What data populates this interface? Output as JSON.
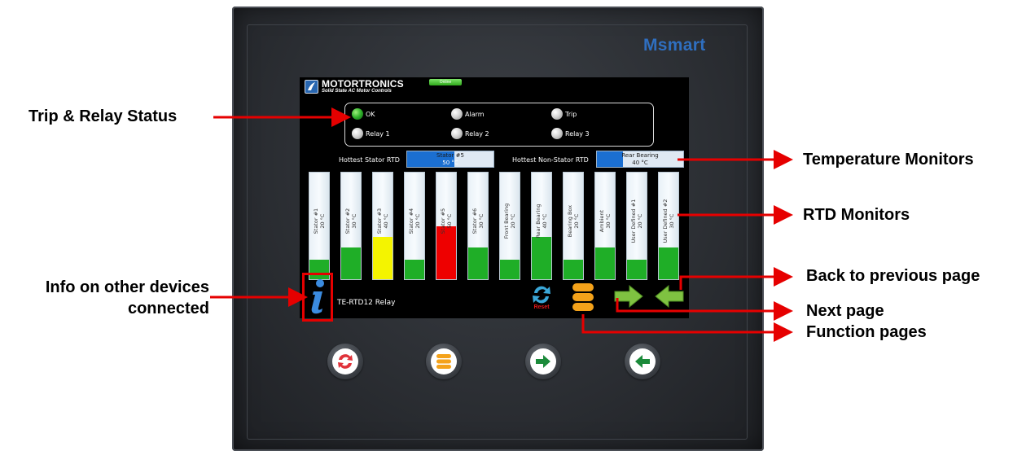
{
  "device": {
    "brand": "Msmart"
  },
  "screen": {
    "logo_title": "MOTORTRONICS",
    "logo_subtitle": "Solid State AC Motor Controls",
    "online_label": "Online",
    "status_lamps": [
      {
        "label": "OK",
        "state": "on"
      },
      {
        "label": "Alarm",
        "state": "off"
      },
      {
        "label": "Trip",
        "state": "off"
      },
      {
        "label": "Relay 1",
        "state": "off"
      },
      {
        "label": "Relay 2",
        "state": "off"
      },
      {
        "label": "Relay 3",
        "state": "off"
      }
    ],
    "hottest_stator": {
      "label": "Hottest Stator RTD",
      "name": "Stator #5",
      "value": "50 °C",
      "fill_fraction": 0.55
    },
    "hottest_non_stator": {
      "label": "Hottest Non-Stator RTD",
      "name": "Rear Bearing",
      "value": "40 °C",
      "fill_fraction": 0.3
    },
    "rtds": [
      {
        "name": "Stator #1",
        "value": "20 °C",
        "level": 0.18,
        "color": "#1fae27"
      },
      {
        "name": "Stator #2",
        "value": "30 °C",
        "level": 0.3,
        "color": "#1fae27"
      },
      {
        "name": "Stator #3",
        "value": "40 °C",
        "level": 0.4,
        "color": "#f4f400"
      },
      {
        "name": "Stator #4",
        "value": "20 °C",
        "level": 0.18,
        "color": "#1fae27"
      },
      {
        "name": "Stator #5",
        "value": "50 °C",
        "level": 0.5,
        "color": "#ee0000"
      },
      {
        "name": "Stator #6",
        "value": "30 °C",
        "level": 0.3,
        "color": "#1fae27"
      },
      {
        "name": "Front Bearing",
        "value": "20 °C",
        "level": 0.18,
        "color": "#1fae27"
      },
      {
        "name": "Rear Bearing",
        "value": "40 °C",
        "level": 0.4,
        "color": "#1fae27"
      },
      {
        "name": "Bearing Box",
        "value": "20 °C",
        "level": 0.18,
        "color": "#1fae27"
      },
      {
        "name": "Ambient",
        "value": "30 °C",
        "level": 0.3,
        "color": "#1fae27"
      },
      {
        "name": "User Defined #1",
        "value": "20 °C",
        "level": 0.18,
        "color": "#1fae27"
      },
      {
        "name": "User Defined #2",
        "value": "30 °C",
        "level": 0.3,
        "color": "#1fae27"
      }
    ],
    "relay_name": "TE-RTD12 Relay",
    "reset_label": "Reset"
  },
  "annotations": {
    "trip_relay_status": "Trip & Relay Status",
    "temperature_monitors": "Temperature Monitors",
    "rtd_monitors": "RTD Monitors",
    "back_previous_page": "Back to previous page",
    "info_line1": "Info on other devices",
    "info_line2": "connected",
    "next_page": "Next page",
    "function_pages": "Function pages"
  }
}
